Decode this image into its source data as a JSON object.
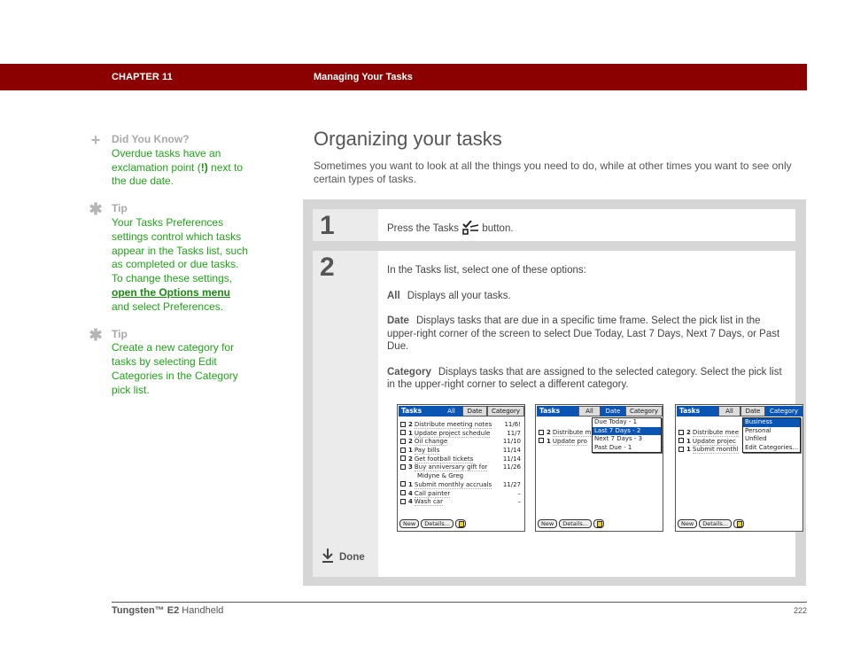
{
  "header": {
    "chapter": "CHAPTER 11",
    "title": "Managing Your Tasks",
    "bar_color": "#8b0000"
  },
  "sidebar": {
    "did_you_know": {
      "icon": "plus-icon",
      "heading": "Did You Know?",
      "text_before": "Overdue tasks have an exclamation point (",
      "text_bold": "!)",
      "text_after": " next to the due date."
    },
    "tip1": {
      "icon": "asterisk-icon",
      "heading": "Tip",
      "text_before": "Your Tasks Preferences settings control which tasks appear in the Tasks list, such as completed or due tasks. To change these settings, ",
      "link": "open the Options menu",
      "text_after": " and select Preferences."
    },
    "tip2": {
      "icon": "asterisk-icon",
      "heading": "Tip",
      "text": "Create a new category for tasks by selecting Edit Categories in the Category pick list."
    }
  },
  "main": {
    "title": "Organizing your tasks",
    "intro": "Sometimes you want to look at all the things you need to do, while at other times you want to see only certain types of tasks.",
    "steps": [
      {
        "number": "1",
        "text_before": "Press the Tasks",
        "icon": "tasks-button-icon",
        "text_after": "button."
      },
      {
        "number": "2",
        "lead": "In the Tasks list, select one of these options:",
        "options": [
          {
            "term": "All",
            "desc": "Displays all your tasks."
          },
          {
            "term": "Date",
            "desc": "Displays tasks that are due in a specific time frame. Select the pick list in the upper-right corner of the screen to select Due Today, Last 7 Days, Next 7 Days, or Past Due."
          },
          {
            "term": "Category",
            "desc": "Displays tasks that are assigned to the selected category. Select the pick list in the upper-right corner to select a different category."
          }
        ],
        "done_label": "Done"
      }
    ]
  },
  "palm": {
    "title": "Tasks",
    "tabs": {
      "all": "All",
      "date": "Date",
      "category": "Category"
    },
    "buttons": {
      "new": "New",
      "details": "Details..."
    },
    "screen1": {
      "rows": [
        {
          "priority": "2",
          "name": "Distribute meeting notes",
          "due": "11/6!"
        },
        {
          "priority": "1",
          "name": "Update project schedule",
          "due": "11/7"
        },
        {
          "priority": "2",
          "name": "Oil change",
          "due": "11/10"
        },
        {
          "priority": "1",
          "name": "Pay bills",
          "due": "11/14"
        },
        {
          "priority": "2",
          "name": "Get football tickets",
          "due": "11/14"
        },
        {
          "priority": "3",
          "name": "Buy anniversary gift for",
          "due": "11/26"
        },
        {
          "continuation": "Midyne & Greg"
        },
        {
          "priority": "1",
          "name": "Submit monthly accruals",
          "due": "11/27"
        },
        {
          "priority": "4",
          "name": "Call painter",
          "due": "–"
        },
        {
          "priority": "4",
          "name": "Wash car",
          "due": "–"
        }
      ]
    },
    "screen2": {
      "rows": [
        {
          "priority": "2",
          "name": "Distribute m"
        },
        {
          "priority": "1",
          "name": "Update pro"
        }
      ],
      "menu": [
        "Due Today - 1",
        "Last 7 Days - 2",
        "Next 7 Days - 3",
        "Past Due - 1"
      ],
      "menu_selected": 1
    },
    "screen3": {
      "rows": [
        {
          "priority": "2",
          "name": "Distribute mee"
        },
        {
          "priority": "1",
          "name": "Update projec"
        },
        {
          "priority": "1",
          "name": "Submit monthl"
        }
      ],
      "menu": [
        "Business",
        "Personal",
        "Unfiled",
        "Edit Categories..."
      ],
      "menu_selected": 0
    }
  },
  "footer": {
    "brand": "Tungsten™",
    "model": "E2",
    "product": "Handheld",
    "page": "222"
  }
}
